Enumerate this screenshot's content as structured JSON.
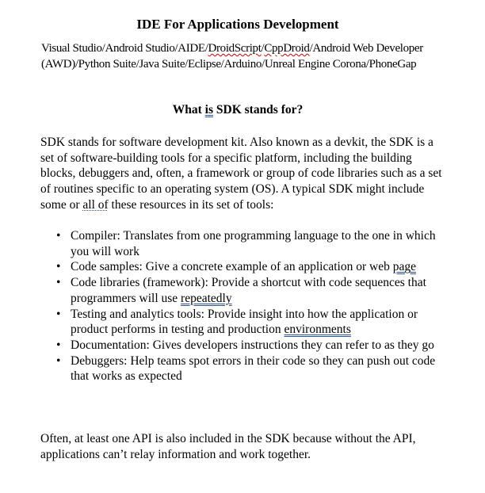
{
  "document": {
    "title": "IDE For Applications Development",
    "ide_list": {
      "part1": "Visual Studio/Android Studio/AIDE/",
      "droidscript": "DroidScript",
      "slash1": "/",
      "cppdroid": "CppDroid",
      "part2": "/Android Web Developer (AWD)/Python Suite/Java Suite/Eclipse/Arduino/Unreal Engine Corona/",
      "phonegap": "PhoneGap"
    },
    "subheading": {
      "pre": "What ",
      "is_word": "is",
      "post": " SDK stands for?"
    },
    "intro": {
      "text1": "SDK stands for software development kit. Also known as a devkit, the SDK is a set of software-building tools for a specific platform, including the building blocks, debuggers and, often, a framework or group of code libraries such as a set of routines specific to an operating system (OS). A typical SDK might include some or ",
      "all_of": "all of",
      "text2": " these resources in its set of tools:"
    },
    "bullets": [
      {
        "text": "Compiler: Translates from one programming language to the one in which you will work",
        "marked": ""
      },
      {
        "text": "Code samples: Give a concrete example of an application or web ",
        "marked": "page"
      },
      {
        "text": "Code libraries (framework): Provide a shortcut with code sequences that programmers will use ",
        "marked": "repeatedly"
      },
      {
        "text": "Testing and analytics tools: Provide insight into how the application or product performs in testing and production ",
        "marked": "environments"
      },
      {
        "text": "Documentation: Gives developers instructions they can refer to as they go",
        "marked": ""
      },
      {
        "text": "Debuggers: Help teams spot errors in their code so they can push out code that works as expected",
        "marked": ""
      }
    ],
    "bullet_glyph": "•",
    "outro": "Often, at least one API is also included in the SDK because without the API, applications can’t relay information and work together."
  },
  "colors": {
    "spelling_underline": "#c00000",
    "grammar_underline": "#2f5597"
  }
}
